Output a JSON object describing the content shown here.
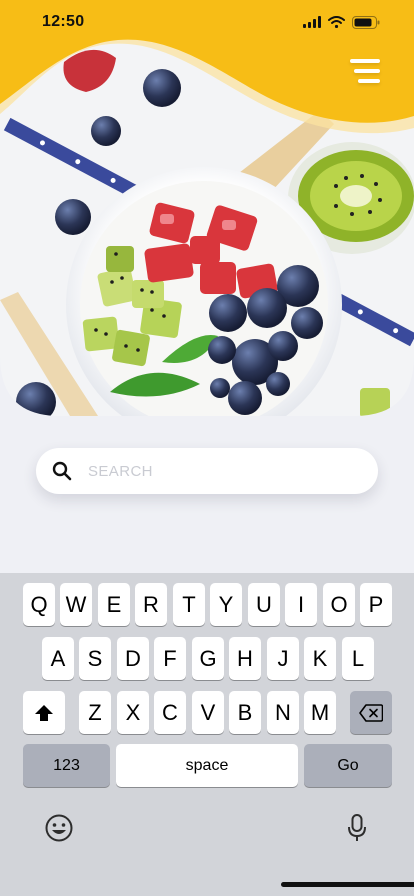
{
  "status_bar": {
    "time": "12:50"
  },
  "search": {
    "placeholder": "SEARCH",
    "value": ""
  },
  "keyboard": {
    "row1": [
      "Q",
      "W",
      "E",
      "R",
      "T",
      "Y",
      "U",
      "I",
      "O",
      "P"
    ],
    "row2": [
      "A",
      "S",
      "D",
      "F",
      "G",
      "H",
      "J",
      "K",
      "L"
    ],
    "row3": [
      "Z",
      "X",
      "C",
      "V",
      "B",
      "N",
      "M"
    ],
    "numbers_label": "123",
    "space_label": "space",
    "go_label": "Go"
  },
  "colors": {
    "accent": "#f7bd16",
    "background": "#eff0f5",
    "keyboard": "#d2d4d9"
  }
}
